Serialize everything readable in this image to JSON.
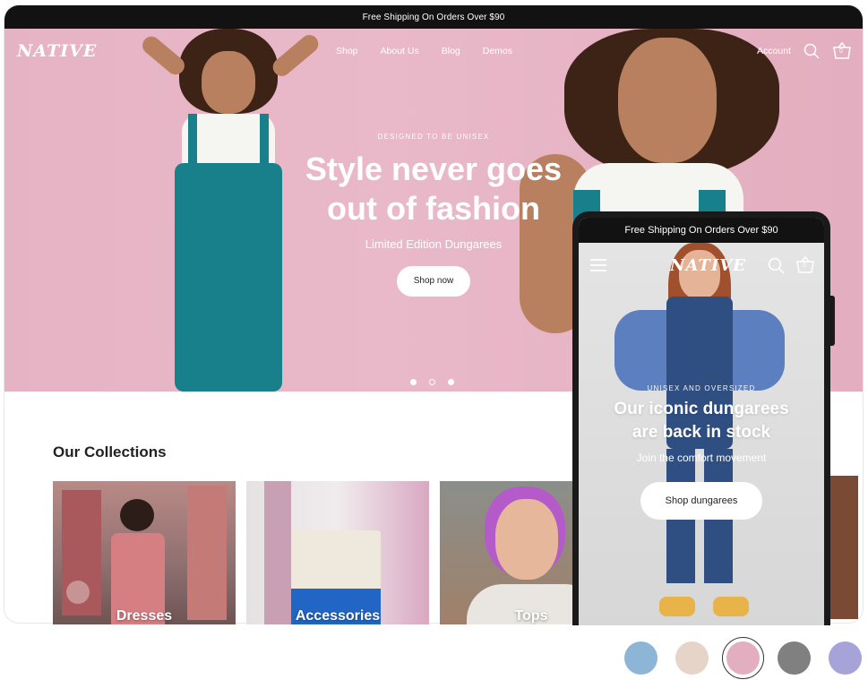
{
  "desktop": {
    "announcement": "Free Shipping On Orders Over $90",
    "logo": "NATIVE",
    "nav": [
      "Shop",
      "About Us",
      "Blog",
      "Demos"
    ],
    "account_label": "Account",
    "cart_count": "0",
    "hero": {
      "eyebrow": "DESIGNED TO BE UNISEX",
      "headline_1": "Style never goes",
      "headline_2": "out of fashion",
      "subline": "Limited Edition Dungarees",
      "cta": "Shop now",
      "slides": 3,
      "active_slide": 2
    },
    "collections_title": "Our Collections",
    "collections": [
      "Dresses",
      "Accessories",
      "Tops"
    ]
  },
  "mobile": {
    "announcement": "Free Shipping On Orders Over $90",
    "logo": "NATIVE",
    "cart_count": "0",
    "hero": {
      "eyebrow": "UNISEX AND OVERSIZED",
      "headline_1": "Our iconic dungarees",
      "headline_2": "are back in stock",
      "subline": "Join the comfort movement",
      "cta": "Shop dungarees"
    }
  },
  "swatches": [
    {
      "color": "#8db6d6",
      "selected": false
    },
    {
      "color": "#e6d4c8",
      "selected": false
    },
    {
      "color": "#e3aebf",
      "selected": true
    },
    {
      "color": "#808080",
      "selected": false
    },
    {
      "color": "#a6a3d8",
      "selected": false
    }
  ]
}
